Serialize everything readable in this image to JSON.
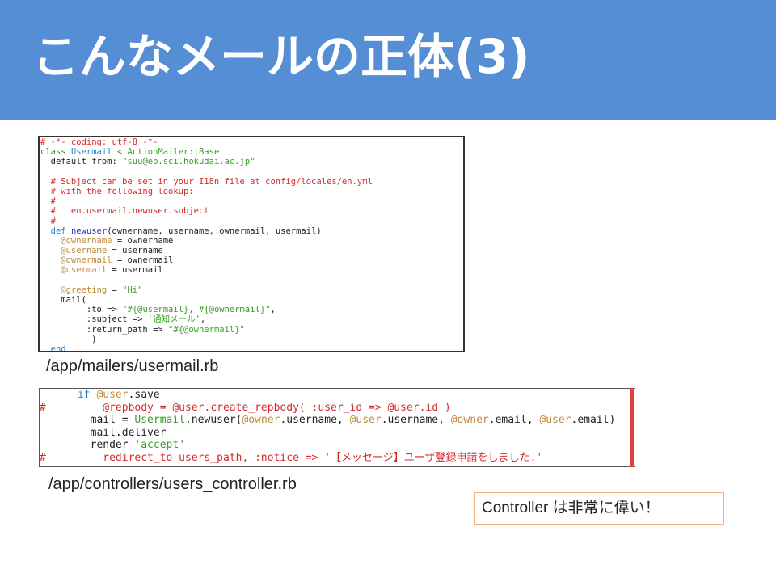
{
  "slide": {
    "title": "こんなメールの正体(3)"
  },
  "code1": {
    "lines": [
      [
        {
          "t": "# -*- coding: utf-8 -*-",
          "c": "red"
        }
      ],
      [
        {
          "t": "class ",
          "c": "green"
        },
        {
          "t": "Usermail",
          "c": "blue"
        },
        {
          "t": " < ActionMailer::Base",
          "c": "green"
        }
      ],
      [
        {
          "t": "  default from: ",
          "c": "txt"
        },
        {
          "t": "\"suu@ep.sci.hokudai.ac.jp\"",
          "c": "green"
        }
      ],
      [
        {
          "t": "",
          "c": "txt"
        }
      ],
      [
        {
          "t": "  # Subject can be set in your I18n file at config/locales/en.yml",
          "c": "red"
        }
      ],
      [
        {
          "t": "  # with the following lookup:",
          "c": "red"
        }
      ],
      [
        {
          "t": "  #",
          "c": "red"
        }
      ],
      [
        {
          "t": "  #   en.usermail.newuser.subject",
          "c": "red"
        }
      ],
      [
        {
          "t": "  #",
          "c": "red"
        }
      ],
      [
        {
          "t": "  def ",
          "c": "blue"
        },
        {
          "t": "newuser",
          "c": "navy"
        },
        {
          "t": "(ownername, username, ownermail, usermail)",
          "c": "txt"
        }
      ],
      [
        {
          "t": "    @ownername",
          "c": "ivar"
        },
        {
          "t": " = ownername",
          "c": "txt"
        }
      ],
      [
        {
          "t": "    @username",
          "c": "ivar"
        },
        {
          "t": " = username",
          "c": "txt"
        }
      ],
      [
        {
          "t": "    @ownermail",
          "c": "ivar"
        },
        {
          "t": " = ownermail",
          "c": "txt"
        }
      ],
      [
        {
          "t": "    @usermail",
          "c": "ivar"
        },
        {
          "t": " = usermail",
          "c": "txt"
        }
      ],
      [
        {
          "t": "",
          "c": "txt"
        }
      ],
      [
        {
          "t": "    @greeting",
          "c": "ivar"
        },
        {
          "t": " = ",
          "c": "txt"
        },
        {
          "t": "\"Hi\"",
          "c": "green"
        }
      ],
      [
        {
          "t": "    mail(",
          "c": "txt"
        }
      ],
      [
        {
          "t": "         :to => ",
          "c": "txt"
        },
        {
          "t": "\"#{@usermail}, #{@ownermail}\"",
          "c": "green"
        },
        {
          "t": ",",
          "c": "txt"
        }
      ],
      [
        {
          "t": "         :subject => ",
          "c": "txt"
        },
        {
          "t": "'通知メール'",
          "c": "green"
        },
        {
          "t": ",",
          "c": "txt"
        }
      ],
      [
        {
          "t": "         :return_path => ",
          "c": "txt"
        },
        {
          "t": "\"#{@ownermail}\"",
          "c": "green"
        }
      ],
      [
        {
          "t": "          )",
          "c": "txt"
        }
      ],
      [
        {
          "t": "  end",
          "c": "blue"
        }
      ]
    ],
    "caption": "/app/mailers/usermail.rb"
  },
  "code2": {
    "lines": [
      [
        {
          "t": "      if ",
          "c": "blue"
        },
        {
          "t": "@user",
          "c": "ivar"
        },
        {
          "t": ".save",
          "c": "txt"
        }
      ],
      [
        {
          "t": "#         @repbody = @user.create_repbody( :user_id => @user.id )",
          "c": "red"
        }
      ],
      [
        {
          "t": "        mail = ",
          "c": "txt"
        },
        {
          "t": "Usermail",
          "c": "green"
        },
        {
          "t": ".newuser(",
          "c": "txt"
        },
        {
          "t": "@owner",
          "c": "ivar"
        },
        {
          "t": ".username, ",
          "c": "txt"
        },
        {
          "t": "@user",
          "c": "ivar"
        },
        {
          "t": ".username, ",
          "c": "txt"
        },
        {
          "t": "@owner",
          "c": "ivar"
        },
        {
          "t": ".email, ",
          "c": "txt"
        },
        {
          "t": "@user",
          "c": "ivar"
        },
        {
          "t": ".email)",
          "c": "txt"
        }
      ],
      [
        {
          "t": "        mail.deliver",
          "c": "txt"
        }
      ],
      [
        {
          "t": "        render ",
          "c": "txt"
        },
        {
          "t": "'accept'",
          "c": "green"
        }
      ],
      [
        {
          "t": "#         redirect_to users_path, :notice => '【メッセージ】ユーザ登録申請をしました.'",
          "c": "red"
        }
      ]
    ],
    "caption": "/app/controllers/users_controller.rb"
  },
  "note": {
    "text": "Controller は非常に偉い！"
  },
  "colors": {
    "header": "#558ed5",
    "red": "#d52a2a",
    "blue": "#2a80c8",
    "green": "#3a9a2a",
    "ivar": "#c08a3a",
    "navy": "#2636b0",
    "note_border": "#f4b183"
  }
}
